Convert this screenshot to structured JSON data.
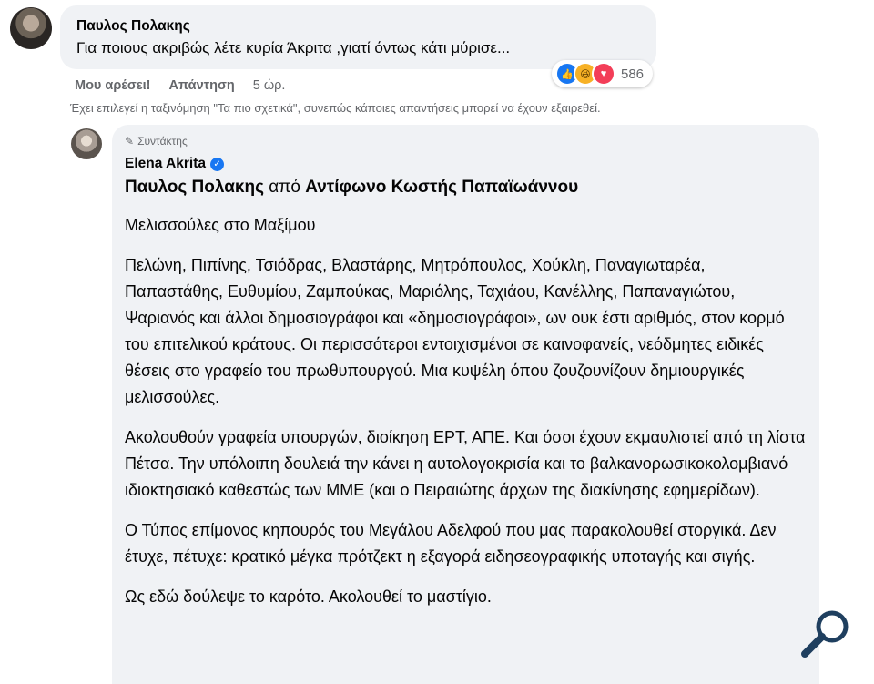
{
  "comment": {
    "author": "Παυλος Πολακης",
    "text": "Για ποιους ακριβώς λέτε κυρία Άκριτα ,γιατί όντως κάτι μύρισε...",
    "reaction_count": "586",
    "reactions": [
      "like-icon",
      "haha-icon",
      "love-icon"
    ],
    "actions": {
      "like": "Μου αρέσει!",
      "reply": "Απάντηση",
      "time": "5 ώρ."
    }
  },
  "sort_notice": "Έχει επιλεγεί η ταξινόμηση \"Τα πιο σχετικά\", συνεπώς κάποιες απαντήσεις μπορεί να έχουν εξαιρεθεί.",
  "reply": {
    "role": "Συντάκτης",
    "author": "Elena Akrita",
    "headline": {
      "part1": "Παυλος Πολακης",
      "connector": "από",
      "part2": "Αντίφωνο Κωστής Παπαϊωάννου"
    },
    "paragraphs": [
      "Μελισσούλες στο Μαξίμου",
      "Πελώνη, Πιπίνης, Τσιόδρας, Βλαστάρης, Μητρόπουλος, Χούκλη, Παναγιωταρέα, Παπαστάθης, Ευθυμίου, Ζαμπούκας, Μαριόλης, Ταχιάου, Κανέλλης, Παπαναγιώτου, Ψαριανός και άλλοι δημοσιογράφοι και «δημοσιογράφοι», ων ουκ έστι αριθμός, στον κορμό του επιτελικού κράτους. Οι περισσότεροι εντοιχισμένοι σε καινοφανείς, νεόδμητες ειδικές θέσεις στο γραφείο του πρωθυπουργού. Μια κυψέλη όπου ζουζουνίζουν δημιουργικές μελισσούλες.",
      "Ακολουθούν γραφεία υπουργών, διοίκηση ΕΡΤ, ΑΠΕ. Και όσοι έχουν εκμαυλιστεί από τη λίστα Πέτσα. Την υπόλοιπη δουλειά την κάνει η αυτολογοκρισία και το βαλκανορωσικοκολομβιανό ιδιοκτησιακό καθεστώς των ΜΜΕ (και ο Πειραιώτης άρχων της διακίνησης εφημερίδων).",
      "Ο Τύπος επίμονος κηπουρός του Μεγάλου Αδελφού που μας παρακολουθεί στοργικά. Δεν έτυχε, πέτυχε: κρατικό μέγκα πρότζεκτ η εξαγορά ειδησεογραφικής υποταγής και σιγής.",
      "Ως εδώ δούλεψε το καρότο. Ακολουθεί το μαστίγιο."
    ]
  },
  "colors": {
    "bubble": "#f0f2f5",
    "meta": "#65676b",
    "accent": "#1877f2"
  }
}
